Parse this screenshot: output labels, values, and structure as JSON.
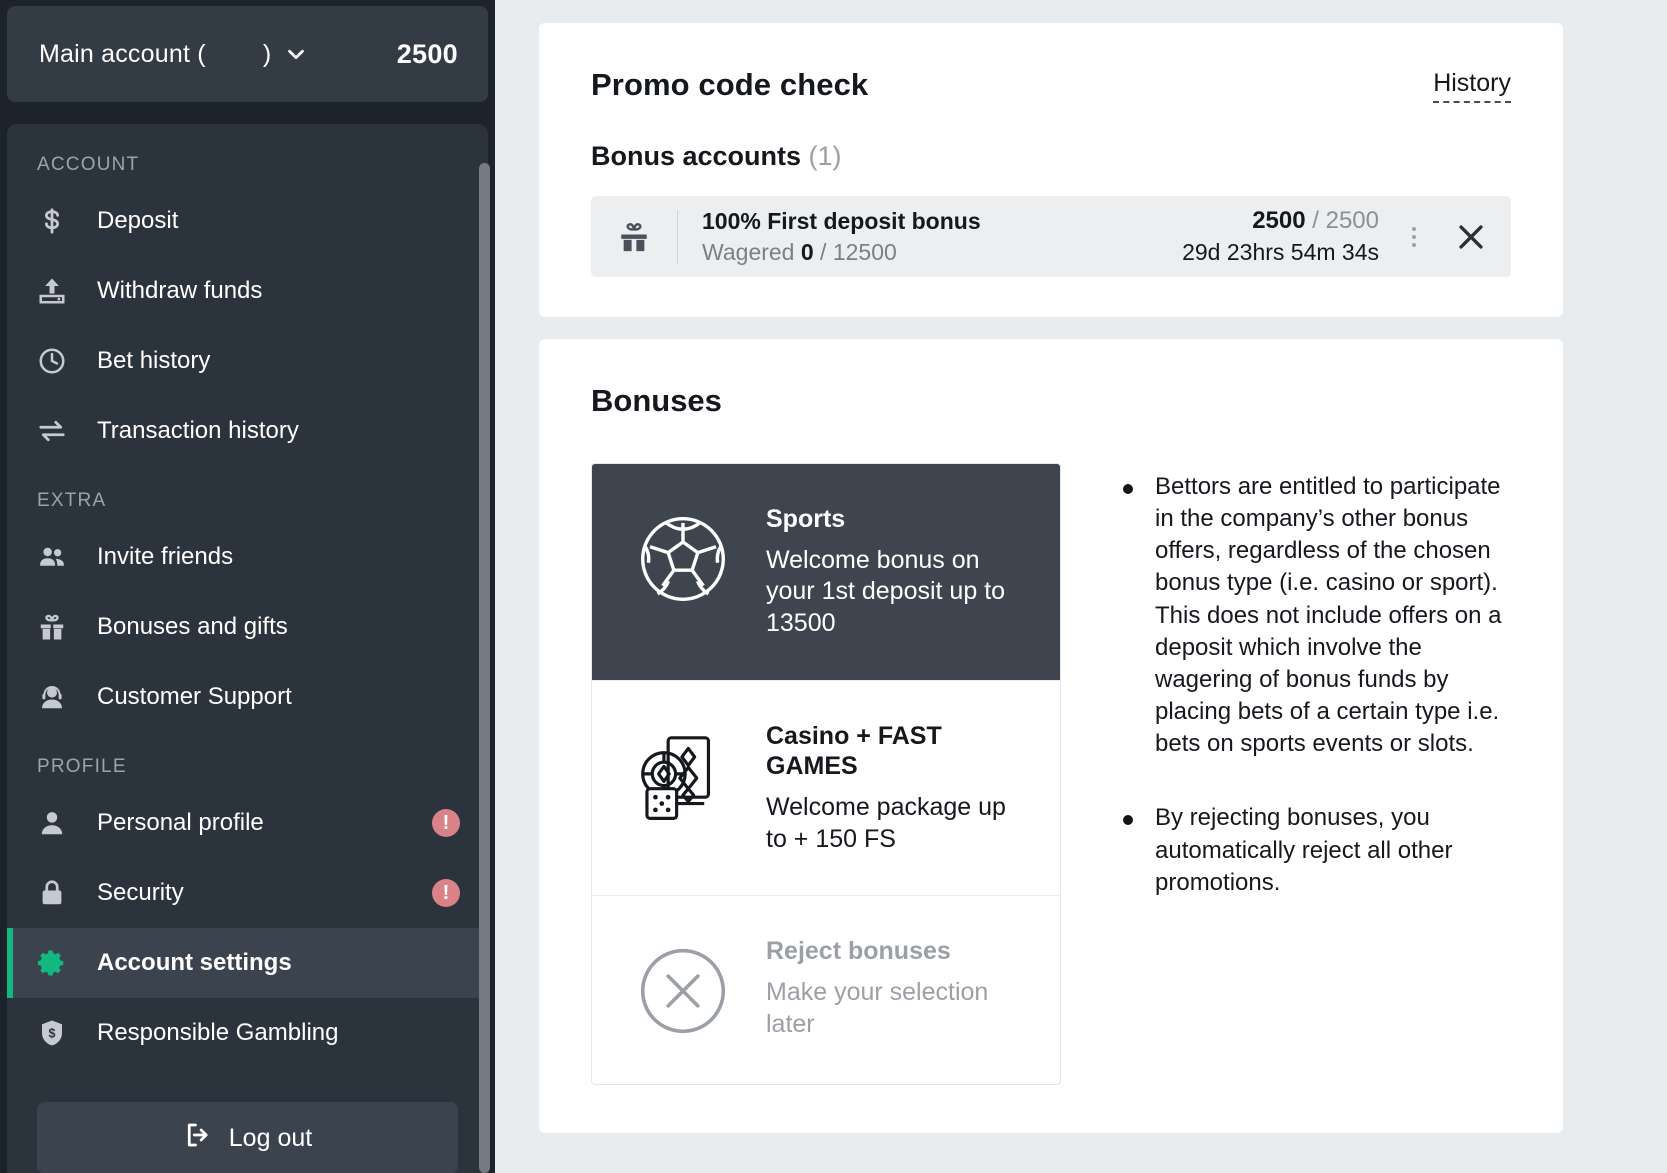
{
  "sidebar": {
    "account": {
      "label": "Main account (        )",
      "balance": "2500",
      "chevron_icon": "chevron-down-icon"
    },
    "sections": [
      {
        "title": "ACCOUNT",
        "items": [
          {
            "label": "Deposit",
            "icon": "dollar-icon",
            "badge": null
          },
          {
            "label": "Withdraw funds",
            "icon": "upload-icon",
            "badge": null
          },
          {
            "label": "Bet history",
            "icon": "clock-icon",
            "badge": null
          },
          {
            "label": "Transaction history",
            "icon": "transfer-icon",
            "badge": null
          }
        ]
      },
      {
        "title": "EXTRA",
        "items": [
          {
            "label": "Invite friends",
            "icon": "people-icon",
            "badge": null
          },
          {
            "label": "Bonuses and gifts",
            "icon": "gift-icon",
            "badge": null
          },
          {
            "label": "Customer Support",
            "icon": "headset-icon",
            "badge": null
          }
        ]
      },
      {
        "title": "PROFILE",
        "items": [
          {
            "label": "Personal profile",
            "icon": "person-icon",
            "badge": "!"
          },
          {
            "label": "Security",
            "icon": "lock-icon",
            "badge": "!"
          },
          {
            "label": "Account settings",
            "icon": "gear-icon",
            "badge": null,
            "active": true
          },
          {
            "label": "Responsible Gambling",
            "icon": "shield-dollar-icon",
            "badge": null
          }
        ]
      }
    ],
    "logout": {
      "label": "Log out",
      "icon": "logout-icon"
    }
  },
  "promo": {
    "title": "Promo code check",
    "history_label": "History",
    "bonus_accounts_label": "Bonus accounts",
    "bonus_accounts_count": "(1)",
    "row": {
      "icon": "gift-icon",
      "title": "100% First deposit bonus",
      "wagered_prefix": "Wagered ",
      "wagered_value": "0",
      "wagered_total": " / 12500",
      "amount_value": "2500",
      "amount_total": " / 2500",
      "time_left": "29d 23hrs 54m 34s",
      "menu_icon": "kebab-menu-icon",
      "close_icon": "close-icon"
    }
  },
  "bonuses": {
    "title": "Bonuses",
    "choices": [
      {
        "icon": "soccer-ball-icon",
        "title": "Sports",
        "desc": "Welcome bonus on your 1st deposit up to 13500",
        "state": "selected"
      },
      {
        "icon": "casino-chips-cards-icon",
        "title": "Casino + FAST GAMES",
        "desc": "Welcome package up to + 150 FS",
        "state": "normal"
      },
      {
        "icon": "circle-x-icon",
        "title": "Reject bonuses",
        "desc": "Make your selection later",
        "state": "muted"
      }
    ],
    "notes": [
      "Bettors are entitled to participate in the company’s other bonus offers, regardless of the chosen bonus type (i.e. casino or sport). This does not include offers on a deposit which involve the wagering of bonus funds by placing bets of a certain type i.e. bets on sports events or slots.",
      "By rejecting bonuses, you automatically reject all other promotions."
    ]
  },
  "colors": {
    "sidebar_bg": "#1d232b",
    "panel_bg": "#2b333c",
    "active_bg": "#3b444e",
    "accent_green": "#11b981",
    "alert_red": "#d98287",
    "main_bg": "#e9ecee",
    "card_bg": "#ffffff",
    "selected_card_bg": "#3e454e"
  }
}
